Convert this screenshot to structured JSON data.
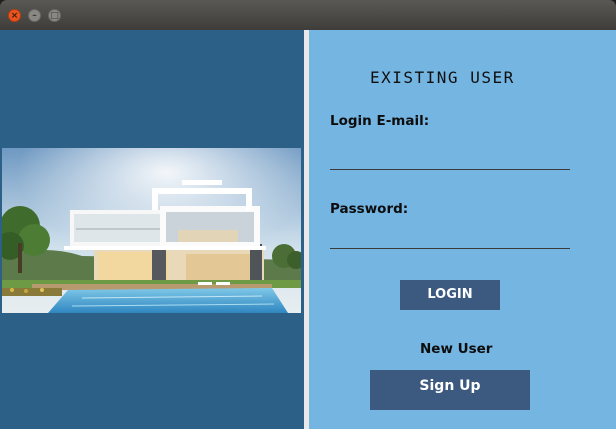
{
  "window": {
    "controls": [
      {
        "name": "close-icon",
        "glyph": "×"
      },
      {
        "name": "minimize-icon",
        "glyph": "–"
      },
      {
        "name": "maximize-icon",
        "glyph": "□"
      }
    ]
  },
  "form": {
    "title": "EXISTING USER",
    "email_label": "Login E-mail:",
    "email_value": "",
    "password_label": "Password:",
    "password_value": "",
    "login_button": "LOGIN",
    "new_user_label": "New User",
    "signup_button": "Sign Up"
  },
  "colors": {
    "left_panel": "#2c6087",
    "right_panel": "#74b5e2",
    "button": "#3c5a80"
  }
}
